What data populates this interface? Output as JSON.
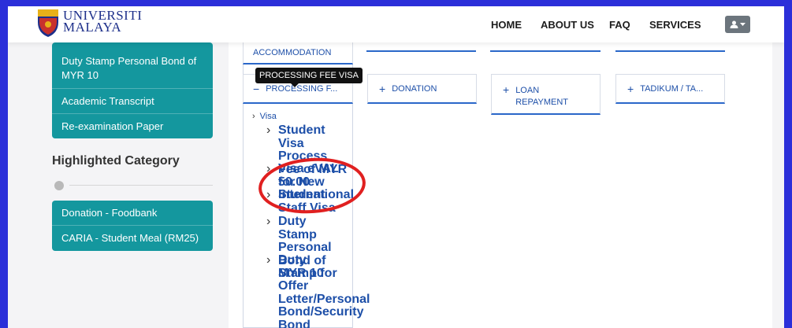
{
  "header": {
    "brand_line1": "UNIVERSITI",
    "brand_line2": "MALAYA",
    "nav": [
      "HOME",
      "ABOUT US",
      "FAQ",
      "SERVICES"
    ]
  },
  "sidebar": {
    "items": [
      "Duty Stamp Personal Bond of MYR 10",
      "Academic Transcript",
      "Re-examination Paper"
    ],
    "highlighted_title": "Highlighted Category",
    "highlighted_items": [
      "Donation - Foodbank",
      "CARIA - Student Meal (RM25)"
    ]
  },
  "catalog": {
    "accommodation": "ACCOMMODATION",
    "tooltip": "PROCESSING FEE VISA",
    "processing": "PROCESSING F...",
    "donation": "DONATION",
    "loan": "LOAN REPAYMENT",
    "tadikum": "TADIKUM / TA...",
    "tree_root": "Visa",
    "tree_items": [
      "Student Visa Process Fee of MYR 50.00",
      "Visa eVAL for New Student",
      "International Staff Visa",
      "Duty Stamp Personal Bond of MYR 10",
      "Duty Stamp for Offer Letter/Personal Bond/Security Bond"
    ]
  },
  "colors": {
    "frame": "#2b2fd9",
    "teal": "#14979e",
    "link_blue": "#1d4fa8",
    "annotation_red": "#e02020"
  }
}
